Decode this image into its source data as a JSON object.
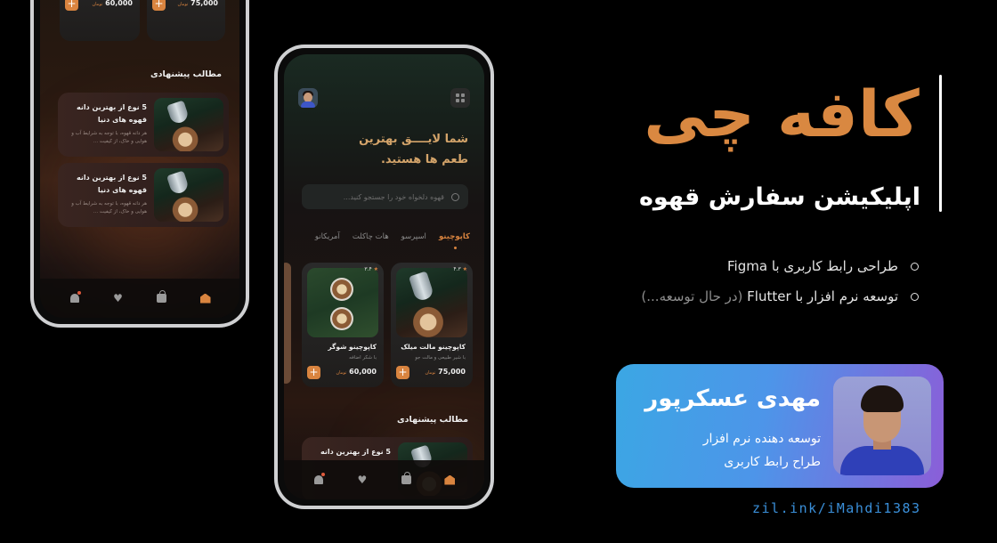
{
  "colors": {
    "accent": "#d98841",
    "background": "#000000",
    "profile_gradient": [
      "#3ba7e4",
      "#8b5ed8"
    ],
    "link": "#3a8fd9"
  },
  "brand": {
    "title": "کافه چی",
    "subtitle": "اپلیکیشن سفارش قهوه"
  },
  "features": [
    {
      "text": "طراحی رابط کاربری با Figma",
      "note": ""
    },
    {
      "text": "توسعه نرم افزار با Flutter",
      "note": "(در حال توسعه...)"
    }
  ],
  "profile": {
    "name": "مهدی عسکرپور",
    "roles": [
      "توسعه دهنده نرم افزار",
      "طراح رابط کاربری"
    ]
  },
  "link": "zil.ink/iMahdi1383",
  "app": {
    "headline": [
      "شما لایــــق بهترین",
      "طعم ها هستید."
    ],
    "search_placeholder": "قهوه دلخواه خود را جستجو کنید...",
    "tabs": [
      "کاپوچینو",
      "اسپرسو",
      "هات چاکلت",
      "آمریکانو"
    ],
    "active_tab": "کاپوچینو",
    "products": [
      {
        "name": "کاپوچینو مالت میلک",
        "sub": "با شیر طبیعی و مالت جو",
        "price": "75,000",
        "currency": "تومان",
        "rating": "۴.۳",
        "image": "latte-art"
      },
      {
        "name": "کاپوچینو شوگر",
        "sub": "با شکر اضافه",
        "price": "60,000",
        "currency": "تومان",
        "rating": "۳.۴",
        "image": "two-cups"
      }
    ],
    "section_title": "مطالب پیشنهادی",
    "articles": [
      {
        "title": "5 نوع از بهترین دانه قهوه های دنیا",
        "body": "هر دانه قهوه، با توجه به شرایط آب و هوایی و خاک، از کیفیت ..."
      },
      {
        "title": "5 نوع از بهترین دانه قهوه های دنیا",
        "body": "هر دانه قهوه، با توجه به شرایط آب و هوایی و خاک، از کیفیت ..."
      }
    ],
    "article_partial": "5 نوع از بهترین دانه",
    "nav": [
      "home-icon",
      "bag-icon",
      "heart-icon",
      "bell-icon"
    ]
  }
}
